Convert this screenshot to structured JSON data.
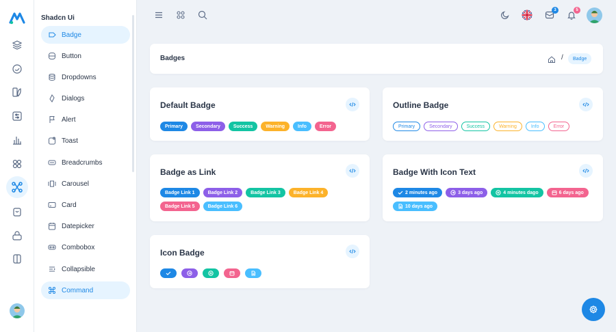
{
  "colors": {
    "primary": "#1e88e5",
    "secondary": "#8d5fe8",
    "success": "#13c4a3",
    "warning": "#fcb22a",
    "info": "#49beff",
    "error": "#f3648f"
  },
  "sidebar": {
    "title": "Shadcn Ui",
    "items": [
      {
        "label": "Badge",
        "icon": "badge-icon",
        "active": true
      },
      {
        "label": "Button",
        "icon": "button-icon"
      },
      {
        "label": "Dropdowns",
        "icon": "database-icon"
      },
      {
        "label": "Dialogs",
        "icon": "dialog-icon"
      },
      {
        "label": "Alert",
        "icon": "flag-icon"
      },
      {
        "label": "Toast",
        "icon": "toast-icon"
      },
      {
        "label": "Breadcrumbs",
        "icon": "breadcrumbs-icon"
      },
      {
        "label": "Carousel",
        "icon": "carousel-icon"
      },
      {
        "label": "Card",
        "icon": "card-icon"
      },
      {
        "label": "Datepicker",
        "icon": "calendar-icon"
      },
      {
        "label": "Combobox",
        "icon": "combobox-icon"
      },
      {
        "label": "Collapsible",
        "icon": "collapsible-icon"
      },
      {
        "label": "Command",
        "icon": "command-icon",
        "active": true
      }
    ]
  },
  "header": {
    "message_count": "3",
    "notification_count": "5"
  },
  "breadcrumb": {
    "title": "Badges",
    "separator": "/",
    "current": "Badge"
  },
  "cards": {
    "default_badge": {
      "title": "Default Badge",
      "badges": [
        "Primary",
        "Secondary",
        "Success",
        "Warning",
        "Info",
        "Error"
      ]
    },
    "outline_badge": {
      "title": "Outline Badge",
      "badges": [
        "Primary",
        "Secondary",
        "Success",
        "Warning",
        "Info",
        "Error"
      ]
    },
    "badge_as_link": {
      "title": "Badge as Link",
      "badges": [
        "Badge Link 1",
        "Badge Link 2",
        "Badge Link 3",
        "Badge Link 4",
        "Badge Link 5",
        "Badge Link 6"
      ]
    },
    "badge_with_icon_text": {
      "title": "Badge With Icon Text",
      "badges": [
        "2 minutes ago",
        "3 days ago",
        "4 minutes dago",
        "6 days ago",
        "10 days ago"
      ]
    },
    "icon_badge": {
      "title": "Icon Badge"
    }
  }
}
